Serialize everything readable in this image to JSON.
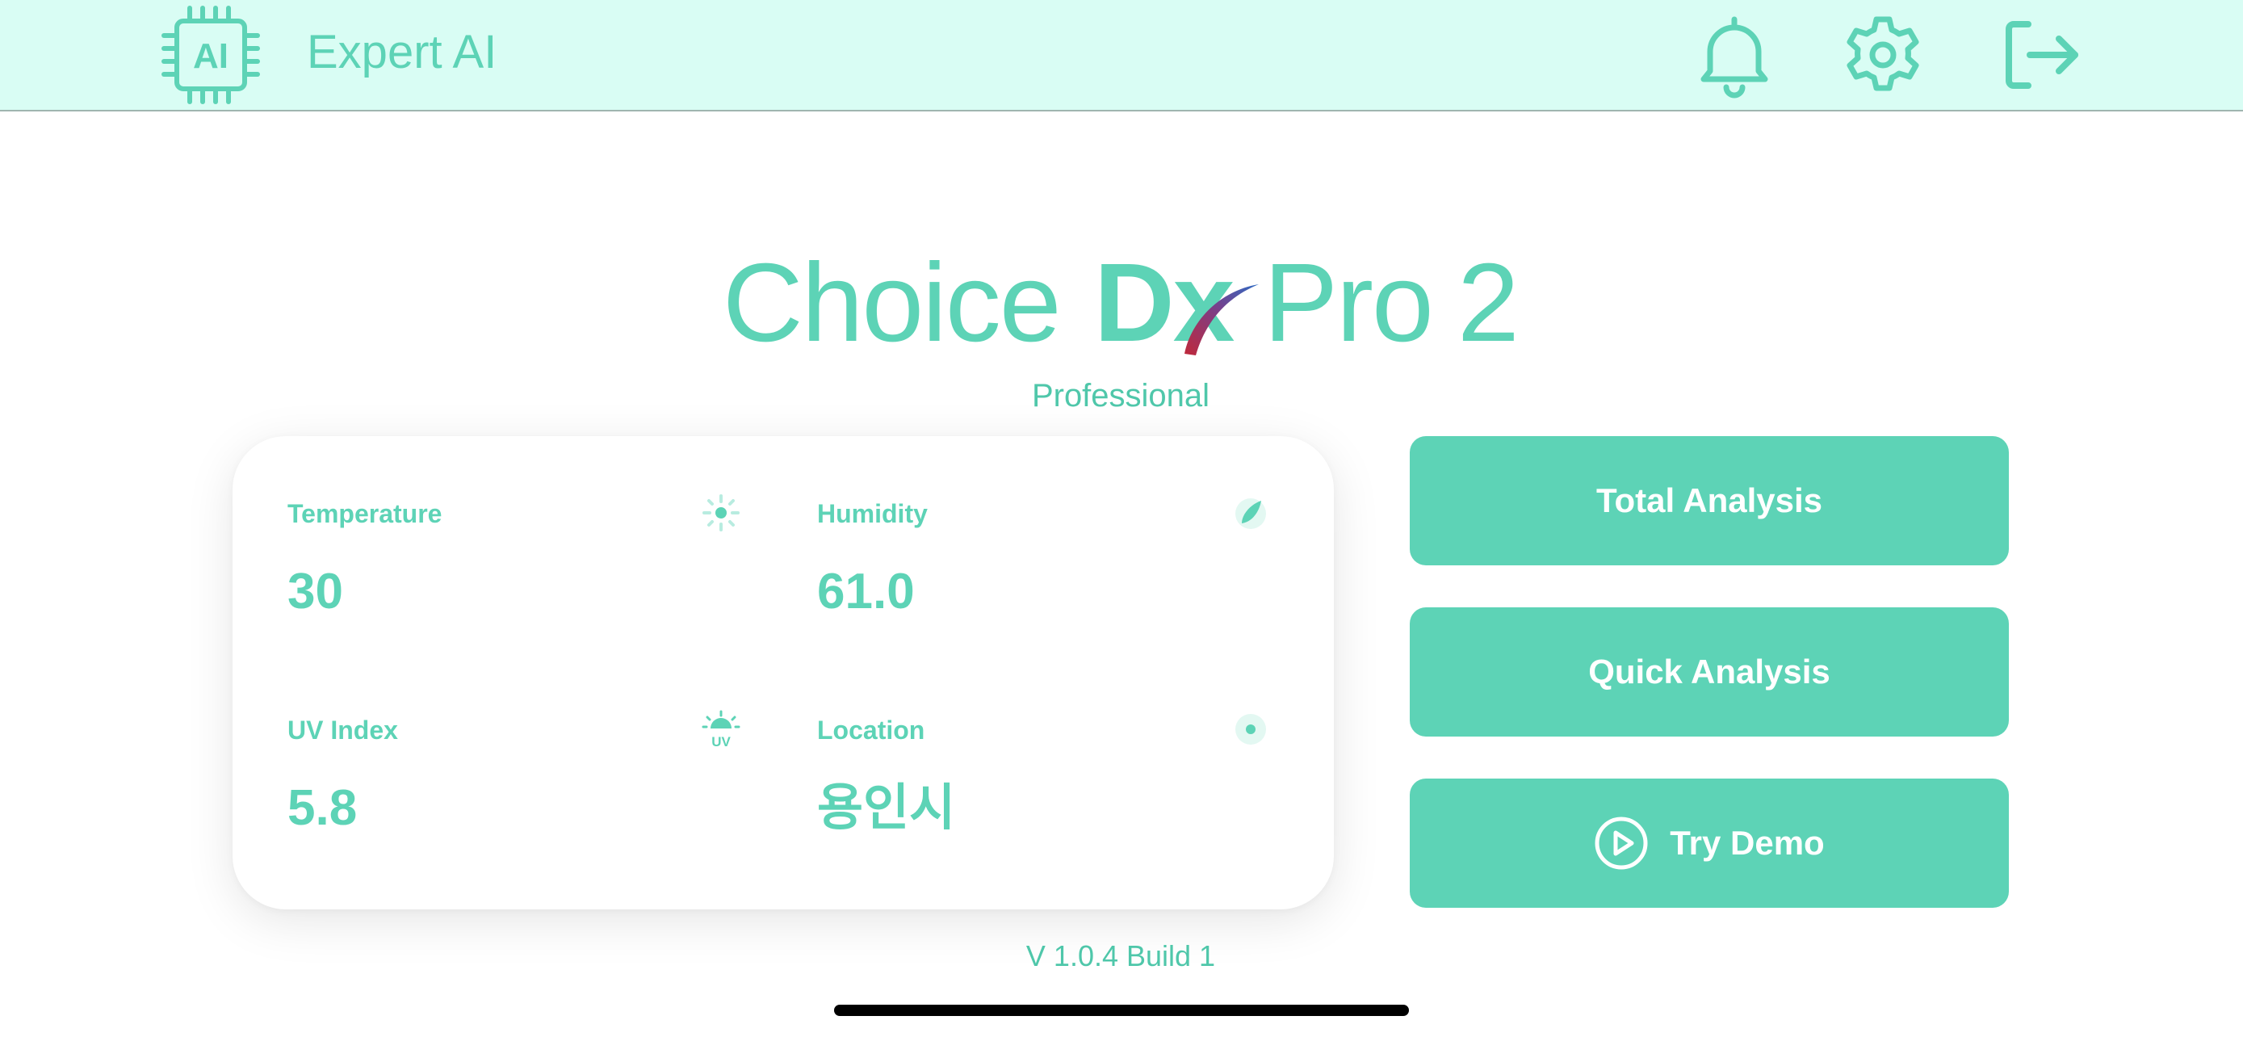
{
  "header": {
    "app_name": "Expert AI",
    "logo_text": "AI",
    "icons": [
      "notification-bell-icon",
      "settings-gear-icon",
      "logout-icon"
    ]
  },
  "product": {
    "name_part1": "Choice",
    "name_part2": "Dx",
    "name_part3": "Pro",
    "name_part4": "2",
    "edition": "Professional"
  },
  "environment": {
    "temperature": {
      "label": "Temperature",
      "value": "30",
      "icon": "sun-icon"
    },
    "humidity": {
      "label": "Humidity",
      "value": "61.0",
      "icon": "water-drop-icon"
    },
    "uv_index": {
      "label": "UV Index",
      "value": "5.8",
      "icon": "uv-sun-icon"
    },
    "location": {
      "label": "Location",
      "value": "용인시",
      "icon": "location-pin-icon"
    }
  },
  "actions": {
    "total_analysis": "Total Analysis",
    "quick_analysis": "Quick Analysis",
    "try_demo": "Try Demo"
  },
  "footer": {
    "version": "V 1.0.4 Build 1"
  },
  "colors": {
    "accent": "#5dd3b6",
    "header_bg": "#d9fdf4",
    "button_text": "#ffffff"
  }
}
